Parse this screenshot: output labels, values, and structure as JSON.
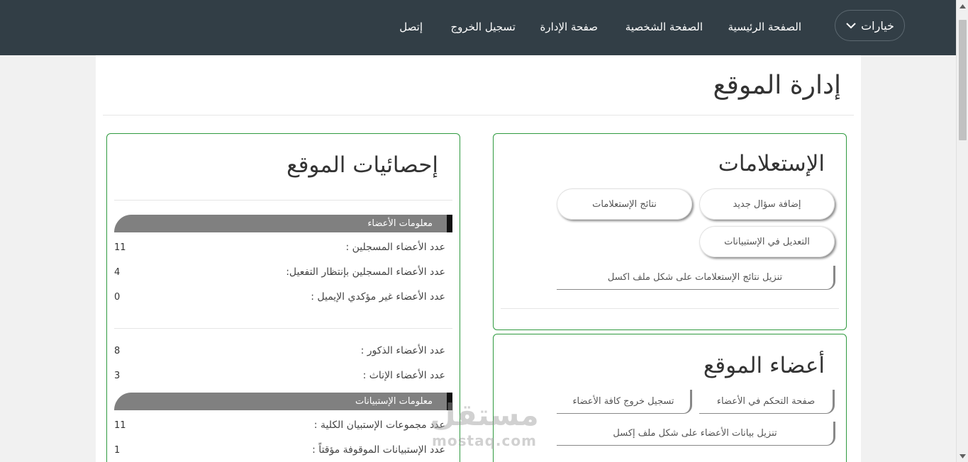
{
  "nav": {
    "options_label": "خيارات",
    "links": [
      "الصفحة الرئيسية",
      "الصفحة الشخصية",
      "صفحة الإدارة",
      "تسجيل الخروج",
      "إتصل"
    ]
  },
  "page": {
    "title": "إدارة الموقع"
  },
  "polls": {
    "title": "الإستعلامات",
    "add_question": "إضافة سؤال جديد",
    "poll_results": "نتائج الإستعلامات",
    "edit_surveys": "التعديل في الإستبيانات",
    "download_excel": "تنزيل نتائج الإستعلامات على شكل ملف اكسل"
  },
  "members": {
    "title": "أعضاء الموقع",
    "control_page": "صفحة التحكم في الأعضاء",
    "logout_all": "تسجيل خروج كافة الأعضاء",
    "download_excel": "تنزيل بيانات الأعضاء على شكل ملف إكسل"
  },
  "stats": {
    "title": "إحصائيات الموقع",
    "members_section": "معلومات الأعضاء",
    "registered_label": "عدد الأعضاء المسجلين :",
    "registered_value": "11",
    "pending_label": "عدد الأعضاء المسجلين بإنتظار التفعيل:",
    "pending_value": "4",
    "unconfirmed_label": "عدد الأعضاء غير مؤكدي الإيميل :",
    "unconfirmed_value": "0",
    "males_label": "عدد الأعضاء الذكور :",
    "males_value": "8",
    "females_label": "عدد الأعضاء الإناث :",
    "females_value": "3",
    "surveys_section": "معلومات الإستبيانات",
    "survey_groups_label": "عدد مجموعات الإستبيان الكلية :",
    "survey_groups_value": "11",
    "paused_label": "عدد الإستبيانات الموقوفة مؤقتاً :",
    "paused_value": "1"
  },
  "watermark": {
    "arabic": "مستقل",
    "latin": "mostaq.com"
  }
}
